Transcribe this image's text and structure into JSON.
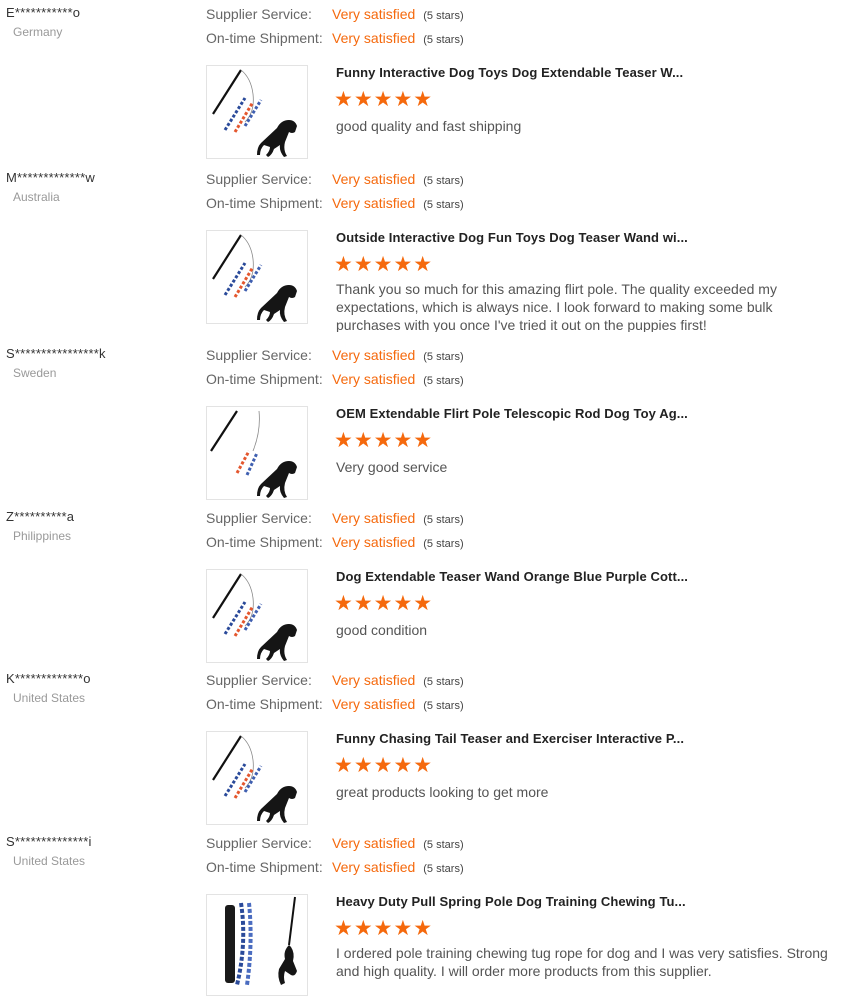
{
  "labels": {
    "supplier_service": "Supplier Service:",
    "ontime_shipment": "On-time Shipment:",
    "star_glyphs": "★★★★★"
  },
  "colors": {
    "accent": "#f5690d",
    "muted": "#999999"
  },
  "reviews": [
    {
      "buyer": "E***********o",
      "country": "Germany",
      "supplier_service": "Very satisfied",
      "supplier_service_stars": "(5 stars)",
      "ontime_shipment": "Very satisfied",
      "ontime_shipment_stars": "(5 stars)",
      "product_title": "Funny Interactive Dog Toys Dog Extendable Teaser W...",
      "rating": 5,
      "comment": "good quality and fast shipping",
      "thumb_icon": "dog-teaser-toy-image"
    },
    {
      "buyer": "M*************w",
      "country": "Australia",
      "supplier_service": "Very satisfied",
      "supplier_service_stars": "(5 stars)",
      "ontime_shipment": "Very satisfied",
      "ontime_shipment_stars": "(5 stars)",
      "product_title": "Outside Interactive Dog Fun Toys Dog Teaser Wand wi...",
      "rating": 5,
      "comment": "Thank you so much for this amazing flirt pole. The quality exceeded my expectations, which is always nice. I look forward to making some bulk purchases with you once I've tried it out on the puppies first!",
      "thumb_icon": "dog-teaser-toy-image"
    },
    {
      "buyer": "S****************k",
      "country": "Sweden",
      "supplier_service": "Very satisfied",
      "supplier_service_stars": "(5 stars)",
      "ontime_shipment": "Very satisfied",
      "ontime_shipment_stars": "(5 stars)",
      "product_title": "OEM Extendable Flirt Pole Telescopic Rod Dog Toy Ag...",
      "rating": 5,
      "comment": "Very good service",
      "thumb_icon": "flirt-pole-image"
    },
    {
      "buyer": "Z**********a",
      "country": "Philippines",
      "supplier_service": "Very satisfied",
      "supplier_service_stars": "(5 stars)",
      "ontime_shipment": "Very satisfied",
      "ontime_shipment_stars": "(5 stars)",
      "product_title": "Dog Extendable Teaser Wand Orange Blue Purple Cott...",
      "rating": 5,
      "comment": "good condition",
      "thumb_icon": "dog-teaser-toy-image"
    },
    {
      "buyer": "K*************o",
      "country": "United States",
      "supplier_service": "Very satisfied",
      "supplier_service_stars": "(5 stars)",
      "ontime_shipment": "Very satisfied",
      "ontime_shipment_stars": "(5 stars)",
      "product_title": "Funny Chasing Tail Teaser and Exerciser Interactive P...",
      "rating": 5,
      "comment": "great products looking to get more",
      "thumb_icon": "dog-teaser-toy-image"
    },
    {
      "buyer": "S**************i",
      "country": "United States",
      "supplier_service": "Very satisfied",
      "supplier_service_stars": "(5 stars)",
      "ontime_shipment": "Very satisfied",
      "ontime_shipment_stars": "(5 stars)",
      "product_title": "Heavy Duty Pull Spring Pole Dog Training Chewing Tu...",
      "rating": 5,
      "comment": "I ordered pole training chewing tug rope for dog and I was very satisfies. Strong and high quality. I will order more products from this supplier.",
      "thumb_icon": "spring-pole-image"
    }
  ]
}
